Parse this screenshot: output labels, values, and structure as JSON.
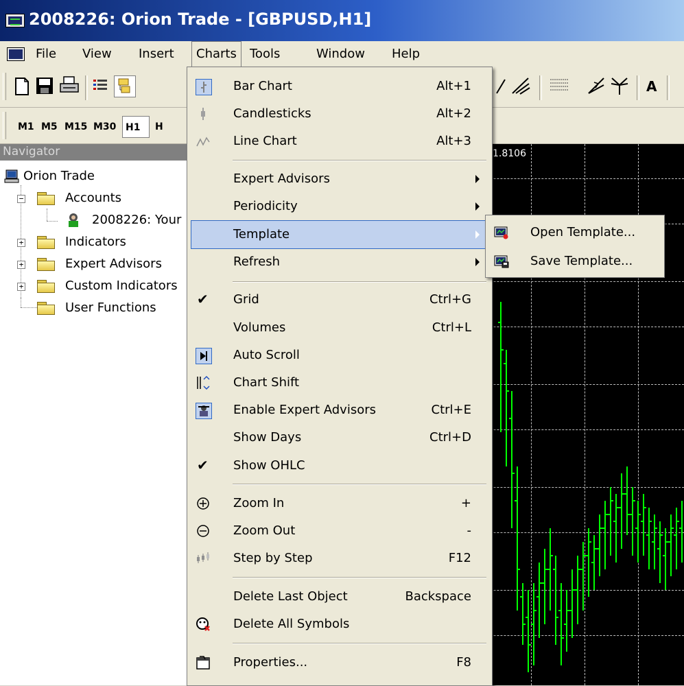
{
  "window": {
    "title": "2008226: Orion Trade - [GBPUSD,H1]"
  },
  "menubar": {
    "items": [
      "File",
      "View",
      "Insert",
      "Charts",
      "Tools",
      "Window",
      "Help"
    ],
    "active": "Charts"
  },
  "toolbar2": {
    "timeframes": [
      "M1",
      "M5",
      "M15",
      "M30",
      "H1",
      "H"
    ],
    "selected": "H1"
  },
  "toolbar1": {
    "text_tool": "A"
  },
  "navigator": {
    "title": "Navigator",
    "tree": {
      "root": "Orion Trade",
      "accounts": "Accounts",
      "account": "2008226: Your",
      "indicators": "Indicators",
      "expert_advisors": "Expert Advisors",
      "custom_indicators": "Custom Indicators",
      "user_functions": "User Functions"
    }
  },
  "chart": {
    "price_label": "1.8106",
    "colors": {
      "background": "#000000",
      "bars": "#00ff00",
      "grid": "#c0c0c0"
    }
  },
  "charts_menu": {
    "items": {
      "bar_chart": {
        "label": "Bar Chart",
        "shortcut": "Alt+1"
      },
      "candlesticks": {
        "label": "Candlesticks",
        "shortcut": "Alt+2"
      },
      "line_chart": {
        "label": "Line Chart",
        "shortcut": "Alt+3"
      },
      "expert_advisors": {
        "label": "Expert Advisors"
      },
      "periodicity": {
        "label": "Periodicity"
      },
      "template": {
        "label": "Template"
      },
      "refresh": {
        "label": "Refresh"
      },
      "grid": {
        "label": "Grid",
        "shortcut": "Ctrl+G"
      },
      "volumes": {
        "label": "Volumes",
        "shortcut": "Ctrl+L"
      },
      "auto_scroll": {
        "label": "Auto Scroll"
      },
      "chart_shift": {
        "label": "Chart Shift"
      },
      "enable_experts": {
        "label": "Enable Expert Advisors",
        "shortcut": "Ctrl+E"
      },
      "show_days": {
        "label": "Show Days",
        "shortcut": "Ctrl+D"
      },
      "show_ohlc": {
        "label": "Show OHLC"
      },
      "zoom_in": {
        "label": "Zoom In",
        "shortcut": "+"
      },
      "zoom_out": {
        "label": "Zoom Out",
        "shortcut": "-"
      },
      "step_by_step": {
        "label": "Step by Step",
        "shortcut": "F12"
      },
      "delete_last": {
        "label": "Delete Last Object",
        "shortcut": "Backspace"
      },
      "delete_all": {
        "label": "Delete All Symbols"
      },
      "properties": {
        "label": "Properties...",
        "shortcut": "F8"
      }
    }
  },
  "template_submenu": {
    "open": "Open Template...",
    "save": "Save Template..."
  }
}
